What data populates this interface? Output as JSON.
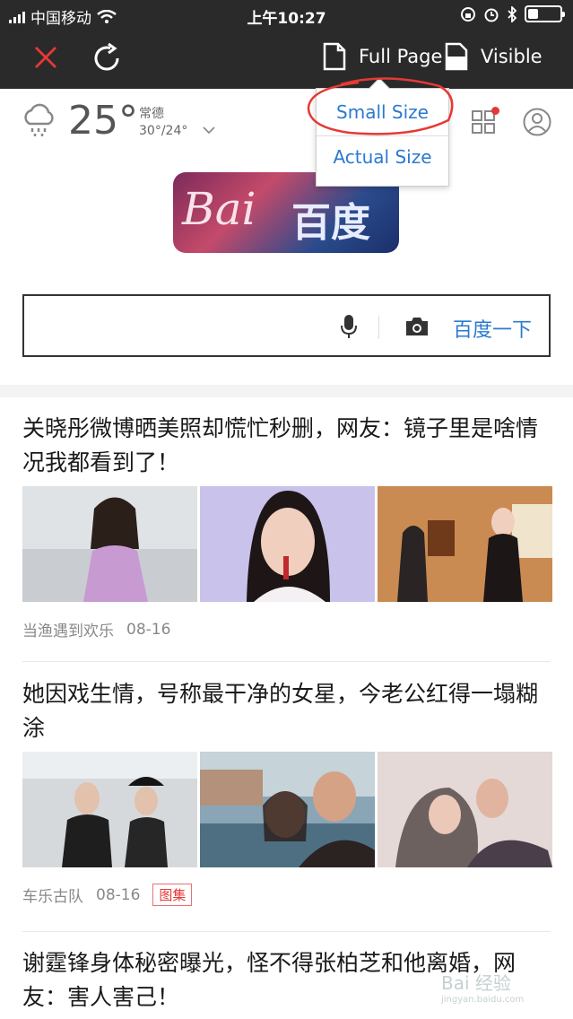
{
  "status_bar": {
    "carrier": "中国移动",
    "time": "上午10:27"
  },
  "toolbar": {
    "close_icon": "close-icon",
    "refresh_icon": "refresh-icon",
    "full_page_label": "Full Page",
    "visible_label": "Visible"
  },
  "popup": {
    "option_small": "Small Size",
    "option_actual": "Actual Size"
  },
  "weather": {
    "temperature": "25°",
    "city": "常德",
    "range": "30°/24°"
  },
  "logo": {
    "text_latin": "Bai",
    "text_cn": "百度"
  },
  "search": {
    "placeholder": "",
    "button_label": "百度一下"
  },
  "feed": [
    {
      "title": "关晓彤微博晒美照却慌忙秒删，网友：镜子里是啥情况我都看到了！",
      "source": "当渔遇到欢乐",
      "date": "08-16",
      "tag": ""
    },
    {
      "title": "她因戏生情，号称最干净的女星，今老公红得一塌糊涂",
      "source": "车乐古队",
      "date": "08-16",
      "tag": "图集"
    },
    {
      "title": "谢霆锋身体秘密曝光，怪不得张柏芝和他离婚，网友：害人害己！",
      "source": "",
      "date": "",
      "tag": ""
    }
  ],
  "watermark": {
    "line1": "Bai 经验",
    "line2": "jingyan.baidu.com"
  },
  "colors": {
    "toolbar_bg": "#2a2a2a",
    "accent_blue": "#2a7ad0",
    "close_red": "#e53935"
  }
}
